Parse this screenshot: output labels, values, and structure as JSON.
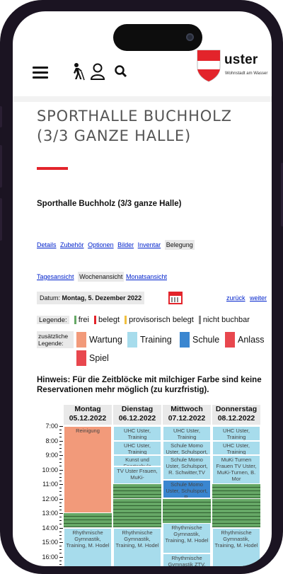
{
  "header": {
    "menu_icon": "hamburger-icon",
    "accessibility_icon": "walking-person-icon",
    "user_icon": "user-icon",
    "search_icon": "search-icon",
    "logo_text": "uster",
    "logo_sub": "Wohnstadt am Wasser"
  },
  "page": {
    "title_line1": "SPORTHALLE BUCHHOLZ",
    "title_line2": "(3/3 GANZE HALLE)",
    "subtitle": "Sporthalle Buchholz (3/3 ganze Halle)"
  },
  "tabs": [
    "Details",
    "Zubehör",
    "Optionen",
    "Bilder",
    "Inventar",
    "Belegung"
  ],
  "views": [
    "Tagesansicht",
    "Wochenansicht",
    "Monatsansicht"
  ],
  "date": {
    "label": "Datum:",
    "value": "Montag, 5. Dezember 2022",
    "back": "zurück",
    "next": "weiter"
  },
  "legend": {
    "label": "Legende:",
    "items": [
      {
        "text": "frei",
        "color": "#66a866"
      },
      {
        "text": "belegt",
        "color": "#e3242b"
      },
      {
        "text": "provisorisch belegt",
        "color": "#f0c040"
      },
      {
        "text": "nicht buchbar",
        "color": "#888888"
      }
    ],
    "extra_label": "zusätzliche Legende:",
    "extra": [
      {
        "text": "Wartung",
        "color": "#f29a7a"
      },
      {
        "text": "Training",
        "color": "#a7dcec"
      },
      {
        "text": "Schule",
        "color": "#3a86d0"
      },
      {
        "text": "Anlass",
        "color": "#e8474e"
      },
      {
        "text": "Spiel",
        "color": "#e8474e"
      }
    ]
  },
  "hint": "Hinweis: Für die Zeitblöcke mit milchiger Farbe sind keine Reservationen mehr möglich (zu kurzfristig).",
  "calendar": {
    "times": [
      "7:00",
      "8:00",
      "9:00",
      "10:00",
      "11:00",
      "12:00",
      "13:00",
      "14:00",
      "15:00",
      "16:00"
    ],
    "days": [
      {
        "name": "Montag",
        "date": "05.12.2022",
        "blocks": [
          {
            "label": "Reinigung",
            "start": 7.0,
            "end": 13.0,
            "color": "#f29a7a"
          },
          {
            "label": "Rhythmische Gymnastik, Training, M. Hodel",
            "start": 14.0,
            "end": 16.8,
            "color": "#a7dcec"
          }
        ]
      },
      {
        "name": "Dienstag",
        "date": "06.12.2022",
        "blocks": [
          {
            "label": "UHC Uster, Training",
            "start": 7.0,
            "end": 8.0,
            "color": "#a7dcec"
          },
          {
            "label": "UHC Uster, Training",
            "start": 8.0,
            "end": 9.0,
            "color": "#a7dcec"
          },
          {
            "label": "Kunst und Sportschule",
            "start": 9.0,
            "end": 9.8,
            "color": "#a7dcec"
          },
          {
            "label": "TV Uster Frauen, MuKi-",
            "start": 9.8,
            "end": 11.0,
            "color": "#a7dcec"
          },
          {
            "label": "Rhythmische Gymnastik, Training, M. Hodel",
            "start": 14.0,
            "end": 16.8,
            "color": "#a7dcec"
          }
        ]
      },
      {
        "name": "Mittwoch",
        "date": "07.12.2022",
        "blocks": [
          {
            "label": "UHC Uster, Training",
            "start": 7.0,
            "end": 8.0,
            "color": "#a7dcec"
          },
          {
            "label": "Schule Momo Uster, Schulsport, R.",
            "start": 8.0,
            "end": 9.0,
            "color": "#a7dcec"
          },
          {
            "label": "Schule Momo Uster, Schulsport, R. Schwitter,TV",
            "start": 9.0,
            "end": 10.7,
            "color": "#a7dcec"
          },
          {
            "label": "Schule Momo Uster, Schulsport, R.",
            "start": 10.7,
            "end": 12.0,
            "color": "#3a86d0"
          },
          {
            "label": "Rhythmische Gymnastik, Training, M. Hodel",
            "start": 13.7,
            "end": 15.8,
            "color": "#a7dcec"
          },
          {
            "label": "Rhythmische Gymnastik ZTV,",
            "start": 15.8,
            "end": 16.8,
            "color": "#a7dcec"
          }
        ]
      },
      {
        "name": "Donnerstag",
        "date": "08.12.2022",
        "blocks": [
          {
            "label": "UHC Uster, Training",
            "start": 7.0,
            "end": 8.0,
            "color": "#a7dcec"
          },
          {
            "label": "UHC Uster, Training",
            "start": 8.0,
            "end": 9.0,
            "color": "#a7dcec"
          },
          {
            "label": "MuKi Turnen Frauen TV Uster, MuKi-Turnen, B. Mor",
            "start": 9.0,
            "end": 11.0,
            "color": "#a7dcec"
          },
          {
            "label": "Rhythmische Gymnastik, Training, M. Hodel",
            "start": 14.0,
            "end": 16.8,
            "color": "#a7dcec"
          }
        ]
      }
    ]
  }
}
